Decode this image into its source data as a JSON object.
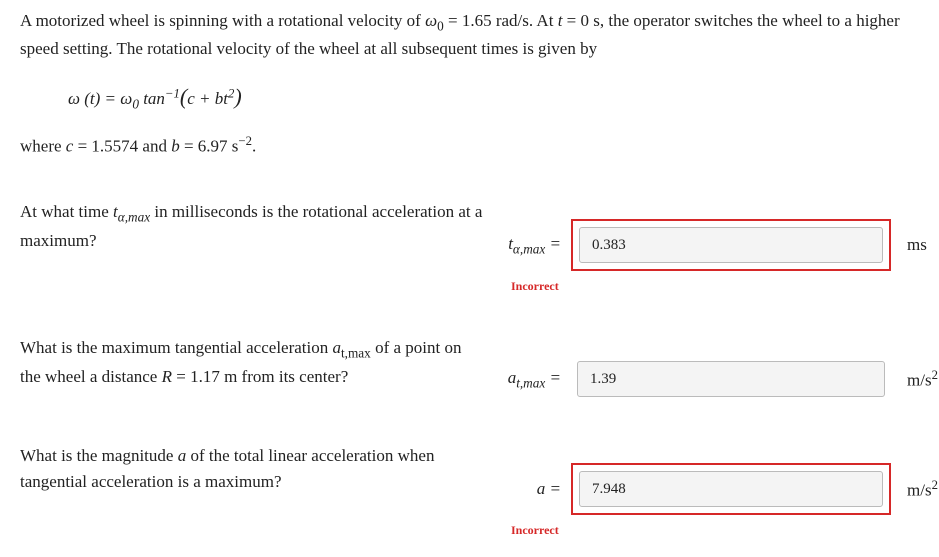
{
  "problem": {
    "intro": "A motorized wheel is spinning with a rotational velocity of ",
    "omega0_var": "ω",
    "omega0_sub": "0",
    "omega0_eq": " = 1.65 rad/s. At ",
    "t0_var": "t",
    "t0_eq": " = 0 s, the operator switches the wheel to a higher speed setting. The rotational velocity of the wheel at all subsequent times is given by",
    "formula_lhs_var": "ω",
    "formula_lhs_arg": " (t) = ",
    "formula_rhs_coeff": "ω",
    "formula_rhs_sub": "0",
    "formula_func": " tan",
    "formula_exp": "−1",
    "formula_open": "(",
    "formula_inner_c": "c + bt",
    "formula_sq": "2",
    "formula_close": ")",
    "constants_pre": "where ",
    "c_var": "c",
    "c_eq": " = 1.5574 and ",
    "b_var": "b",
    "b_eq": " = 6.97 s",
    "b_exp": "−2",
    "b_end": "."
  },
  "q1": {
    "prompt_pre": "At what time ",
    "prompt_var": "t",
    "prompt_sub": "α,max",
    "prompt_post": " in milliseconds is the rotational acceleration at a maximum?",
    "label_var": "t",
    "label_sub": "α,max",
    "label_eq": " =",
    "value": "0.383",
    "unit": "ms",
    "feedback": "Incorrect"
  },
  "q2": {
    "prompt_pre": "What is the maximum tangential acceleration ",
    "prompt_var": "a",
    "prompt_sub": "t,max",
    "prompt_mid": " of a point on the wheel a distance ",
    "R_var": "R",
    "R_eq": " = 1.17 m from its center?",
    "label_var": "a",
    "label_sub": "t,max",
    "label_eq": " =",
    "value": "1.39",
    "unit_base": "m/s",
    "unit_exp": "2"
  },
  "q3": {
    "prompt_pre": "What is the magnitude ",
    "prompt_var": "a",
    "prompt_post": " of the total linear acceleration when tangential acceleration is a maximum?",
    "label_var": "a",
    "label_eq": " =",
    "value": "7.948",
    "unit_base": "m/s",
    "unit_exp": "2",
    "feedback": "Incorrect"
  }
}
